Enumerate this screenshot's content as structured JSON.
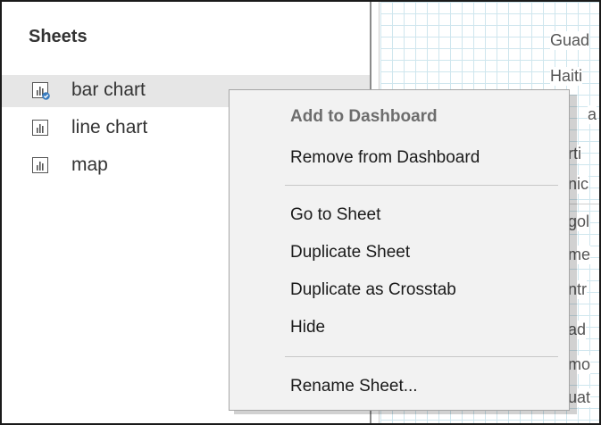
{
  "sheets_panel": {
    "title": "Sheets",
    "items": [
      {
        "label": "bar chart",
        "selected": true,
        "icon": "worksheet-icon-with-check-badge"
      },
      {
        "label": "line chart",
        "selected": false,
        "icon": "worksheet-icon"
      },
      {
        "label": "map",
        "selected": false,
        "icon": "worksheet-icon"
      }
    ]
  },
  "canvas": {
    "visible_text": [
      "Guad",
      "Haiti",
      "a",
      "rti",
      "nic",
      "gol",
      "me",
      "ntr",
      "ad",
      "mo",
      "uat"
    ]
  },
  "context_menu": {
    "items": [
      {
        "label": "Add to Dashboard",
        "enabled": false
      },
      {
        "label": "Remove from Dashboard",
        "enabled": true
      },
      {
        "label": "Go to Sheet",
        "enabled": true
      },
      {
        "label": "Duplicate Sheet",
        "enabled": true
      },
      {
        "label": "Duplicate as Crosstab",
        "enabled": true
      },
      {
        "label": "Hide",
        "enabled": true
      },
      {
        "label": "Rename Sheet...",
        "enabled": true
      }
    ]
  },
  "colors": {
    "selected_row": "#e6e6e6",
    "menu_background": "#f2f2f2",
    "check_badge": "#3b7dbf",
    "grid_line": "#cfe6ee"
  }
}
